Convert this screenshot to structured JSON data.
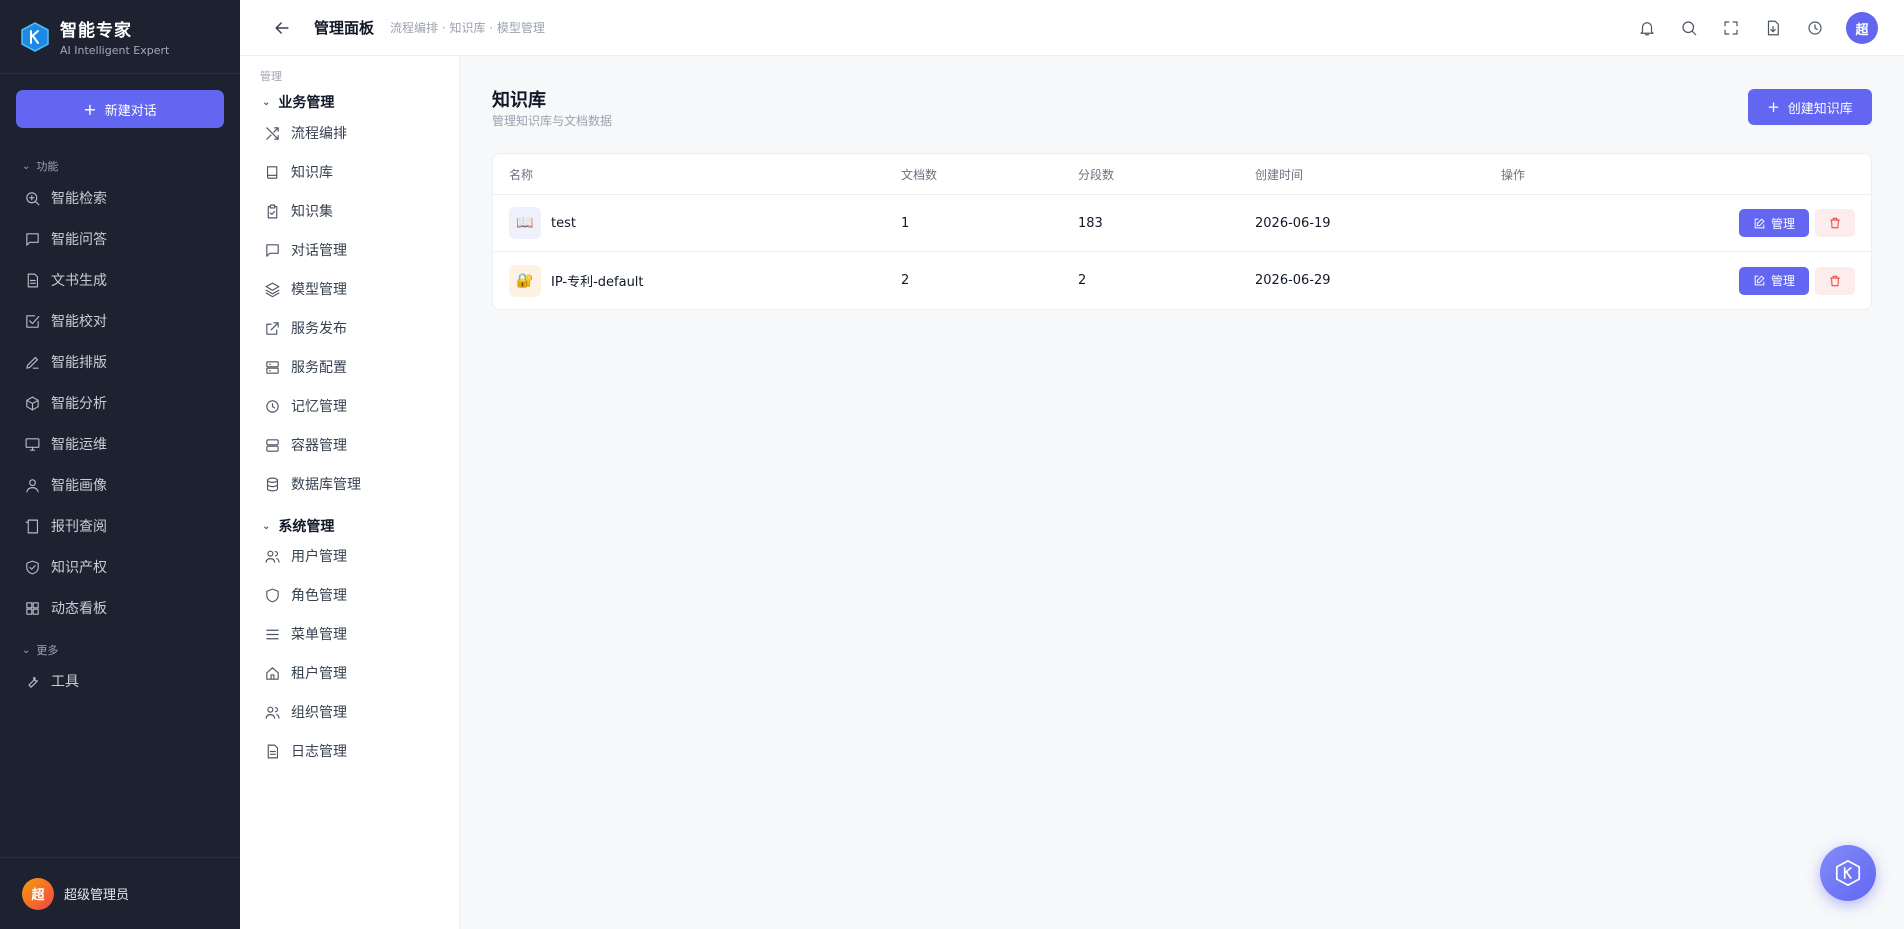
{
  "brand": {
    "name": "智能专家",
    "subtitle": "AI Intelligent Expert"
  },
  "sidebar": {
    "new_chat_label": "新建对话",
    "section_features": "功能",
    "section_more": "更多",
    "items": [
      {
        "label": "智能检索",
        "icon": "search-plus-icon"
      },
      {
        "label": "智能问答",
        "icon": "chat-bubble-icon"
      },
      {
        "label": "文书生成",
        "icon": "document-icon"
      },
      {
        "label": "智能校对",
        "icon": "check-square-icon"
      },
      {
        "label": "智能排版",
        "icon": "pen-icon"
      },
      {
        "label": "智能分析",
        "icon": "cube-icon"
      },
      {
        "label": "智能运维",
        "icon": "monitor-icon"
      },
      {
        "label": "智能画像",
        "icon": "user-icon"
      },
      {
        "label": "报刊查阅",
        "icon": "newspaper-icon"
      },
      {
        "label": "知识产权",
        "icon": "shield-check-icon"
      },
      {
        "label": "动态看板",
        "icon": "grid-icon"
      }
    ],
    "more_items": [
      {
        "label": "工具",
        "icon": "wrench-icon"
      }
    ],
    "user": {
      "avatar_text": "超",
      "name": "超级管理员"
    }
  },
  "header": {
    "title": "管理面板",
    "breadcrumb": "流程编排 · 知识库 · 模型管理",
    "avatar_text": "超"
  },
  "admin_menu": {
    "section": "管理",
    "groups": [
      {
        "label": "业务管理",
        "items": [
          {
            "label": "流程编排",
            "icon": "shuffle-icon"
          },
          {
            "label": "知识库",
            "icon": "book-icon"
          },
          {
            "label": "知识集",
            "icon": "clipboard-icon"
          },
          {
            "label": "对话管理",
            "icon": "chat-bubble-icon"
          },
          {
            "label": "模型管理",
            "icon": "layers-icon"
          },
          {
            "label": "服务发布",
            "icon": "external-link-icon"
          },
          {
            "label": "服务配置",
            "icon": "server-icon"
          },
          {
            "label": "记忆管理",
            "icon": "clock-icon"
          },
          {
            "label": "容器管理",
            "icon": "container-icon"
          },
          {
            "label": "数据库管理",
            "icon": "database-icon"
          }
        ]
      },
      {
        "label": "系统管理",
        "items": [
          {
            "label": "用户管理",
            "icon": "users-icon"
          },
          {
            "label": "角色管理",
            "icon": "shield-icon"
          },
          {
            "label": "菜单管理",
            "icon": "menu-icon"
          },
          {
            "label": "租户管理",
            "icon": "home-icon"
          },
          {
            "label": "组织管理",
            "icon": "users-icon"
          },
          {
            "label": "日志管理",
            "icon": "file-text-icon"
          }
        ]
      }
    ]
  },
  "main": {
    "title": "知识库",
    "subtitle": "管理知识库与文档数据",
    "create_label": "创建知识库",
    "columns": [
      "名称",
      "文档数",
      "分段数",
      "创建时间",
      "操作"
    ],
    "rows": [
      {
        "icon": "📖",
        "name": "test",
        "docs": "1",
        "segments": "183",
        "created": "2026-06-19"
      },
      {
        "icon": "🔐",
        "name": "IP-专利-default",
        "docs": "2",
        "segments": "2",
        "created": "2026-06-29"
      }
    ],
    "manage_label": "管理"
  },
  "colors": {
    "accent": "#6366f1",
    "sidebar_bg": "#1e2130",
    "danger": "#ef4444"
  }
}
